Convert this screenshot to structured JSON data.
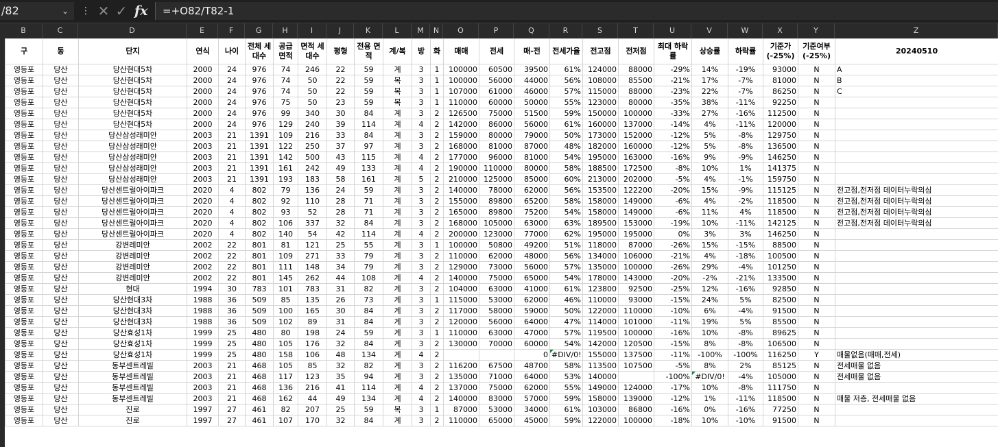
{
  "formula_bar": {
    "name_box": "/82",
    "formula": "=+O82/T82-1",
    "fx_label": "fx",
    "cancel_icon": "close-icon",
    "confirm_icon": "check-icon"
  },
  "column_letters": [
    "B",
    "C",
    "D",
    "E",
    "F",
    "G",
    "H",
    "I",
    "J",
    "K",
    "L",
    "M",
    "N",
    "O",
    "P",
    "Q",
    "R",
    "S",
    "T",
    "U",
    "V",
    "W",
    "X",
    "Y",
    "Z"
  ],
  "header_row": [
    "구",
    "동",
    "단지",
    "연식",
    "나이",
    "전체 세대수",
    "공급 면적",
    "면적 세대수",
    "평형",
    "전용 면적",
    "계/복",
    "방",
    "화",
    "매매",
    "전세",
    "매-전",
    "전세가율",
    "전고점",
    "전저점",
    "최대 하락률",
    "상승률",
    "하락률",
    "기준가 (-25%)",
    "기준여부 (-25%)",
    "20240510"
  ],
  "rows": [
    [
      "영등포",
      "당산",
      "당산현대5차",
      "2000",
      "24",
      "976",
      "74",
      "246",
      "22",
      "59",
      "계",
      "3",
      "1",
      "100000",
      "60500",
      "39500",
      "61%",
      "124000",
      "88000",
      "-29%",
      "14%",
      "-19%",
      "93000",
      "N",
      "A"
    ],
    [
      "영등포",
      "당산",
      "당산현대5차",
      "2000",
      "24",
      "976",
      "74",
      "50",
      "22",
      "59",
      "복",
      "3",
      "1",
      "100000",
      "56000",
      "44000",
      "56%",
      "108000",
      "85500",
      "-21%",
      "17%",
      "-7%",
      "81000",
      "N",
      "B"
    ],
    [
      "영등포",
      "당산",
      "당산현대5차",
      "2000",
      "24",
      "976",
      "74",
      "50",
      "22",
      "59",
      "복",
      "3",
      "1",
      "107000",
      "61000",
      "46000",
      "57%",
      "115000",
      "88000",
      "-23%",
      "22%",
      "-7%",
      "86250",
      "N",
      "C"
    ],
    [
      "영등포",
      "당산",
      "당산현대5차",
      "2000",
      "24",
      "976",
      "75",
      "50",
      "23",
      "59",
      "복",
      "3",
      "1",
      "110000",
      "60000",
      "50000",
      "55%",
      "123000",
      "80000",
      "-35%",
      "38%",
      "-11%",
      "92250",
      "N",
      ""
    ],
    [
      "영등포",
      "당산",
      "당산현대5차",
      "2000",
      "24",
      "976",
      "99",
      "340",
      "30",
      "84",
      "계",
      "3",
      "2",
      "126500",
      "75000",
      "51500",
      "59%",
      "150000",
      "100000",
      "-33%",
      "27%",
      "-16%",
      "112500",
      "N",
      ""
    ],
    [
      "영등포",
      "당산",
      "당산현대5차",
      "2000",
      "24",
      "976",
      "129",
      "240",
      "39",
      "114",
      "계",
      "4",
      "2",
      "142000",
      "86000",
      "56000",
      "61%",
      "160000",
      "137000",
      "-14%",
      "4%",
      "-11%",
      "120000",
      "N",
      ""
    ],
    [
      "영등포",
      "당산",
      "당산삼성래미안",
      "2003",
      "21",
      "1391",
      "109",
      "216",
      "33",
      "84",
      "계",
      "3",
      "2",
      "159000",
      "80000",
      "79000",
      "50%",
      "173000",
      "152000",
      "-12%",
      "5%",
      "-8%",
      "129750",
      "N",
      ""
    ],
    [
      "영등포",
      "당산",
      "당산삼성래미안",
      "2003",
      "21",
      "1391",
      "122",
      "250",
      "37",
      "97",
      "계",
      "3",
      "2",
      "168000",
      "81000",
      "87000",
      "48%",
      "182000",
      "160000",
      "-12%",
      "5%",
      "-8%",
      "136500",
      "N",
      ""
    ],
    [
      "영등포",
      "당산",
      "당산삼성래미안",
      "2003",
      "21",
      "1391",
      "142",
      "500",
      "43",
      "115",
      "계",
      "4",
      "2",
      "177000",
      "96000",
      "81000",
      "54%",
      "195000",
      "163000",
      "-16%",
      "9%",
      "-9%",
      "146250",
      "N",
      ""
    ],
    [
      "영등포",
      "당산",
      "당산삼성래미안",
      "2003",
      "21",
      "1391",
      "161",
      "242",
      "49",
      "133",
      "계",
      "4",
      "2",
      "190000",
      "110000",
      "80000",
      "58%",
      "188500",
      "172500",
      "-8%",
      "10%",
      "1%",
      "141375",
      "N",
      ""
    ],
    [
      "영등포",
      "당산",
      "당산삼성래미안",
      "2003",
      "21",
      "1391",
      "193",
      "183",
      "58",
      "161",
      "계",
      "5",
      "2",
      "210000",
      "125000",
      "85000",
      "60%",
      "213000",
      "202000",
      "-5%",
      "4%",
      "-1%",
      "159750",
      "N",
      ""
    ],
    [
      "영등포",
      "당산",
      "당산센트럴아이파크",
      "2020",
      "4",
      "802",
      "79",
      "136",
      "24",
      "59",
      "계",
      "3",
      "2",
      "140000",
      "78000",
      "62000",
      "56%",
      "153500",
      "122200",
      "-20%",
      "15%",
      "-9%",
      "115125",
      "N",
      "전고점,전저점 데이터누락의심"
    ],
    [
      "영등포",
      "당산",
      "당산센트럴아이파크",
      "2020",
      "4",
      "802",
      "92",
      "110",
      "28",
      "71",
      "계",
      "3",
      "2",
      "155000",
      "89800",
      "65200",
      "58%",
      "158000",
      "149000",
      "-6%",
      "4%",
      "-2%",
      "118500",
      "N",
      "전고점,전저점 데이터누락의심"
    ],
    [
      "영등포",
      "당산",
      "당산센트럴아이파크",
      "2020",
      "4",
      "802",
      "93",
      "52",
      "28",
      "71",
      "계",
      "3",
      "2",
      "165000",
      "89800",
      "75200",
      "54%",
      "158000",
      "149000",
      "-6%",
      "11%",
      "4%",
      "118500",
      "N",
      "전고점,전저점 데이터누락의심"
    ],
    [
      "영등포",
      "당산",
      "당산센트럴아이파크",
      "2020",
      "4",
      "802",
      "106",
      "337",
      "32",
      "84",
      "계",
      "3",
      "2",
      "168000",
      "105000",
      "63000",
      "63%",
      "189500",
      "153000",
      "-19%",
      "10%",
      "-11%",
      "142125",
      "N",
      "전고점,전저점 데이터누락의심"
    ],
    [
      "영등포",
      "당산",
      "당산센트럴아이파크",
      "2020",
      "4",
      "802",
      "140",
      "54",
      "42",
      "114",
      "계",
      "4",
      "2",
      "200000",
      "123000",
      "77000",
      "62%",
      "195000",
      "195000",
      "0%",
      "3%",
      "3%",
      "146250",
      "N",
      ""
    ],
    [
      "영등포",
      "당산",
      "강변레미안",
      "2002",
      "22",
      "801",
      "81",
      "121",
      "25",
      "55",
      "계",
      "3",
      "1",
      "100000",
      "50800",
      "49200",
      "51%",
      "118000",
      "87000",
      "-26%",
      "15%",
      "-15%",
      "88500",
      "N",
      ""
    ],
    [
      "영등포",
      "당산",
      "강변레미안",
      "2002",
      "22",
      "801",
      "109",
      "271",
      "33",
      "79",
      "계",
      "3",
      "2",
      "110000",
      "62000",
      "48000",
      "56%",
      "134000",
      "106000",
      "-21%",
      "4%",
      "-18%",
      "100500",
      "N",
      ""
    ],
    [
      "영등포",
      "당산",
      "강변레미안",
      "2002",
      "22",
      "801",
      "111",
      "148",
      "34",
      "79",
      "계",
      "3",
      "2",
      "129000",
      "73000",
      "56000",
      "57%",
      "135000",
      "100000",
      "-26%",
      "29%",
      "-4%",
      "101250",
      "N",
      ""
    ],
    [
      "영등포",
      "당산",
      "강변레미안",
      "2002",
      "22",
      "801",
      "145",
      "262",
      "44",
      "108",
      "계",
      "4",
      "2",
      "140000",
      "75000",
      "65000",
      "54%",
      "178000",
      "143000",
      "-20%",
      "-2%",
      "-21%",
      "133500",
      "N",
      ""
    ],
    [
      "영등포",
      "당산",
      "현대",
      "1994",
      "30",
      "783",
      "101",
      "783",
      "31",
      "82",
      "계",
      "3",
      "2",
      "104000",
      "63000",
      "41000",
      "61%",
      "123800",
      "92500",
      "-25%",
      "12%",
      "-16%",
      "92850",
      "N",
      ""
    ],
    [
      "영등포",
      "당산",
      "당산현대3차",
      "1988",
      "36",
      "509",
      "85",
      "135",
      "26",
      "73",
      "계",
      "3",
      "1",
      "115000",
      "53000",
      "62000",
      "46%",
      "110000",
      "93000",
      "-15%",
      "24%",
      "5%",
      "82500",
      "N",
      ""
    ],
    [
      "영등포",
      "당산",
      "당산현대3차",
      "1988",
      "36",
      "509",
      "100",
      "165",
      "30",
      "84",
      "계",
      "3",
      "2",
      "117000",
      "58000",
      "59000",
      "50%",
      "122000",
      "110000",
      "-10%",
      "6%",
      "-4%",
      "91500",
      "N",
      ""
    ],
    [
      "영등포",
      "당산",
      "당산현대3차",
      "1988",
      "36",
      "509",
      "102",
      "89",
      "31",
      "84",
      "계",
      "3",
      "2",
      "120000",
      "56000",
      "64000",
      "47%",
      "114000",
      "101000",
      "-11%",
      "19%",
      "5%",
      "85500",
      "N",
      ""
    ],
    [
      "영등포",
      "당산",
      "당산효성1차",
      "1999",
      "25",
      "480",
      "80",
      "198",
      "24",
      "59",
      "계",
      "3",
      "1",
      "110000",
      "63000",
      "47000",
      "57%",
      "119500",
      "100000",
      "-16%",
      "10%",
      "-8%",
      "89625",
      "N",
      ""
    ],
    [
      "영등포",
      "당산",
      "당산효성1차",
      "1999",
      "25",
      "480",
      "105",
      "176",
      "32",
      "84",
      "계",
      "3",
      "2",
      "130000",
      "70000",
      "60000",
      "54%",
      "142000",
      "120500",
      "-15%",
      "8%",
      "-8%",
      "106500",
      "N",
      ""
    ],
    [
      "영등포",
      "당산",
      "당산효성1차",
      "1999",
      "25",
      "480",
      "158",
      "106",
      "48",
      "134",
      "계",
      "4",
      "2",
      "",
      "",
      "0",
      "#DIV/0!",
      "155000",
      "137500",
      "-11%",
      "-100%",
      "-100%",
      "116250",
      "Y",
      "매물없음(매매,전세)"
    ],
    [
      "영등포",
      "당산",
      "동부센트레빌",
      "2003",
      "21",
      "468",
      "105",
      "85",
      "32",
      "82",
      "계",
      "3",
      "2",
      "116200",
      "67500",
      "48700",
      "58%",
      "113500",
      "107500",
      "-5%",
      "8%",
      "2%",
      "85125",
      "N",
      "전세매물 없음"
    ],
    [
      "영등포",
      "당산",
      "동부센트레빌",
      "2003",
      "21",
      "468",
      "117",
      "123",
      "35",
      "94",
      "계",
      "3",
      "2",
      "135000",
      "71000",
      "64000",
      "53%",
      "140000",
      "",
      "-100%",
      "#DIV/0!",
      "-4%",
      "105000",
      "N",
      "전세매물 없음"
    ],
    [
      "영등포",
      "당산",
      "동부센트레빌",
      "2003",
      "21",
      "468",
      "136",
      "216",
      "41",
      "114",
      "계",
      "4",
      "2",
      "137000",
      "75000",
      "62000",
      "55%",
      "149000",
      "124000",
      "-17%",
      "10%",
      "-8%",
      "111750",
      "N",
      ""
    ],
    [
      "영등포",
      "당산",
      "동부센트레빌",
      "2003",
      "21",
      "468",
      "162",
      "44",
      "49",
      "134",
      "계",
      "4",
      "2",
      "140000",
      "83000",
      "57000",
      "59%",
      "158000",
      "139000",
      "-12%",
      "1%",
      "-11%",
      "118500",
      "N",
      "매물 저층, 전세매물 없음"
    ],
    [
      "영등포",
      "당산",
      "진로",
      "1997",
      "27",
      "461",
      "82",
      "207",
      "25",
      "59",
      "복",
      "3",
      "1",
      "87000",
      "53000",
      "34000",
      "61%",
      "103000",
      "86800",
      "-16%",
      "0%",
      "-16%",
      "77250",
      "N",
      ""
    ],
    [
      "영등포",
      "당산",
      "진로",
      "1997",
      "27",
      "461",
      "107",
      "170",
      "32",
      "84",
      "계",
      "3",
      "2",
      "110000",
      "65000",
      "45000",
      "59%",
      "122000",
      "100000",
      "-18%",
      "10%",
      "-10%",
      "91500",
      "N",
      ""
    ]
  ]
}
